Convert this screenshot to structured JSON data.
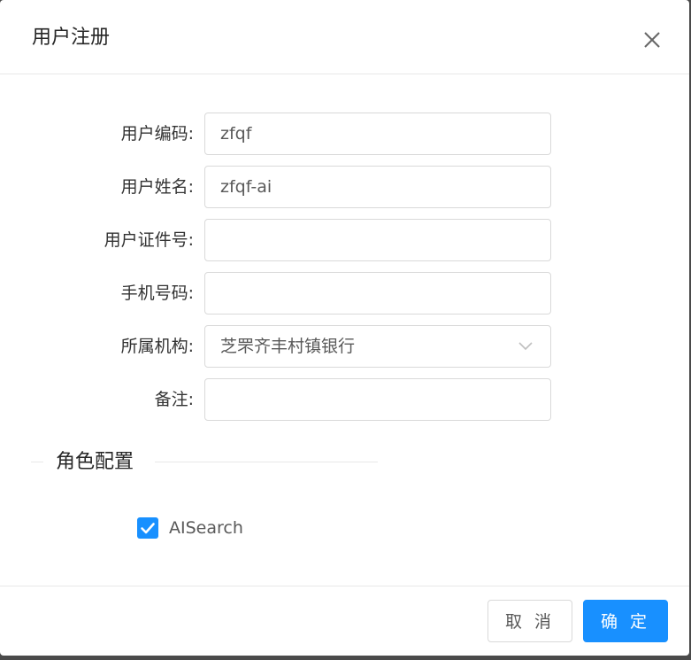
{
  "dialog": {
    "title": "用户注册",
    "close_icon": "close-icon"
  },
  "form": {
    "fields": [
      {
        "label": "用户编码:",
        "value": "zfqf",
        "placeholder": ""
      },
      {
        "label": "用户姓名:",
        "value": "zfqf-ai",
        "placeholder": ""
      },
      {
        "label": "用户证件号:",
        "value": "",
        "placeholder": ""
      },
      {
        "label": "手机号码:",
        "value": "",
        "placeholder": ""
      },
      {
        "label": "所属机构:",
        "value": "芝罘齐丰村镇银行",
        "icon": "chevron-down-icon"
      },
      {
        "label": "备注:",
        "value": "",
        "placeholder": ""
      }
    ]
  },
  "roles": {
    "section_title": "角色配置",
    "items": [
      {
        "label": "AISearch",
        "checked": true
      }
    ]
  },
  "footer": {
    "cancel_label": "取 消",
    "ok_label": "确 定"
  },
  "colors": {
    "primary": "#1890ff",
    "border": "#d9d9d9",
    "text": "#333333"
  }
}
